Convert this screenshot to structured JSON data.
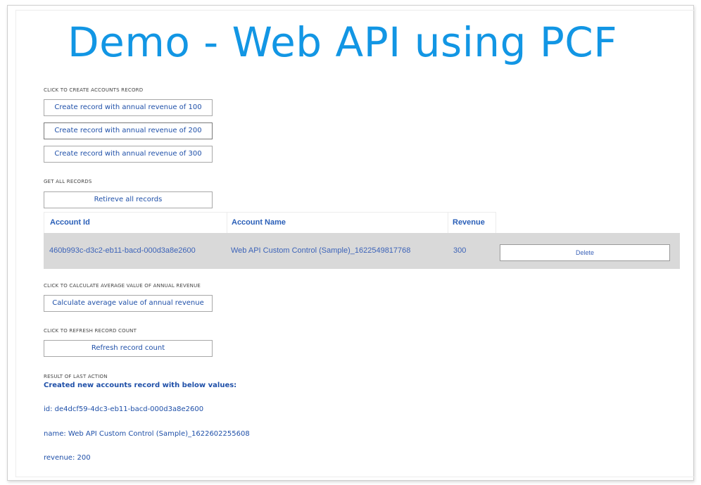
{
  "title": "Demo - Web API using PCF",
  "create_section": {
    "label": "CLICK TO CREATE ACCOUNTS RECORD",
    "buttons": [
      "Create record with annual revenue of 100",
      "Create record with annual revenue of 200",
      "Create record with annual revenue of 300"
    ]
  },
  "get_section": {
    "label": "GET ALL RECORDS",
    "button": "Retireve all records"
  },
  "table": {
    "headers": [
      "Account Id",
      "Account Name",
      "Revenue"
    ],
    "rows": [
      {
        "account_id": "460b993c-d3c2-eb11-bacd-000d3a8e2600",
        "account_name": "Web API Custom Control (Sample)_1622549817768",
        "revenue": "300",
        "action": "Delete"
      }
    ]
  },
  "average_section": {
    "label": "CLICK TO CALCULATE AVERAGE VALUE OF ANNUAL REVENUE",
    "button": "Calculate average value of annual revenue"
  },
  "refresh_section": {
    "label": "CLICK TO REFRESH RECORD COUNT",
    "button": "Refresh record count"
  },
  "result_section": {
    "label": "RESULT OF LAST ACTION",
    "heading": "Created new accounts record with below values:",
    "id_line": "id: de4dcf59-4dc3-eb11-bacd-000d3a8e2600",
    "name_line": "name: Web API Custom Control (Sample)_1622602255608",
    "revenue_line": "revenue: 200"
  }
}
